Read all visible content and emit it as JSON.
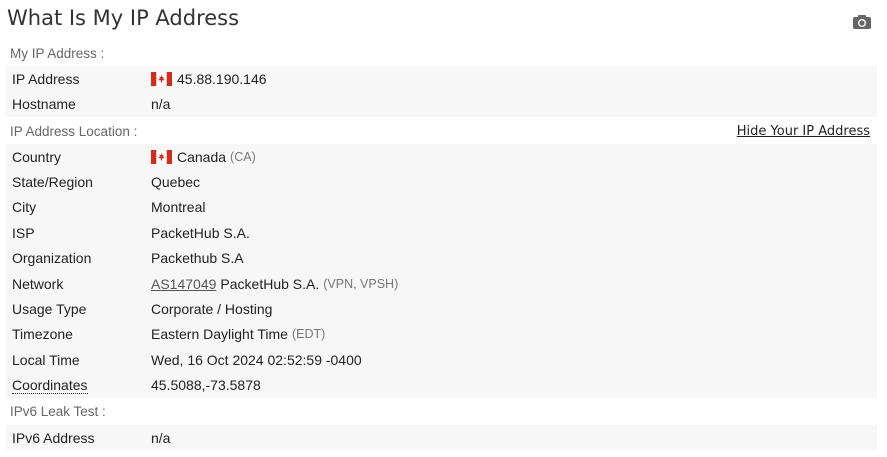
{
  "page": {
    "title": "What Is My IP Address",
    "camera_icon": "camera-icon"
  },
  "sections": {
    "my_ip": "My IP Address :",
    "location": "IP Address Location :",
    "ipv6": "IPv6 Leak Test :"
  },
  "hide_link": "Hide Your IP Address",
  "my_ip": {
    "ip_label": "IP Address",
    "ip_value": "45.88.190.146",
    "host_label": "Hostname",
    "host_value": "n/a"
  },
  "location": {
    "country_label": "Country",
    "country_value": "Canada",
    "country_code": "(CA)",
    "state_label": "State/Region",
    "state_value": "Quebec",
    "city_label": "City",
    "city_value": "Montreal",
    "isp_label": "ISP",
    "isp_value": "PacketHub S.A.",
    "org_label": "Organization",
    "org_value": "Packethub S.A",
    "network_label": "Network",
    "network_asn": "AS147049",
    "network_name": "PacketHub S.A.",
    "network_type": "(VPN, VPSH)",
    "usage_label": "Usage Type",
    "usage_value": "Corporate / Hosting",
    "tz_label": "Timezone",
    "tz_value": "Eastern Daylight Time",
    "tz_abbr": "(EDT)",
    "time_label": "Local Time",
    "time_value": "Wed, 16 Oct 2024 02:52:59 -0400",
    "coord_label": "Coordinates",
    "coord_value": "45.5088,-73.5878"
  },
  "ipv6": {
    "label": "IPv6 Address",
    "value": "n/a"
  },
  "colors": {
    "flag_red": "#d52b1e",
    "row_bg": "#f7f7f7"
  }
}
